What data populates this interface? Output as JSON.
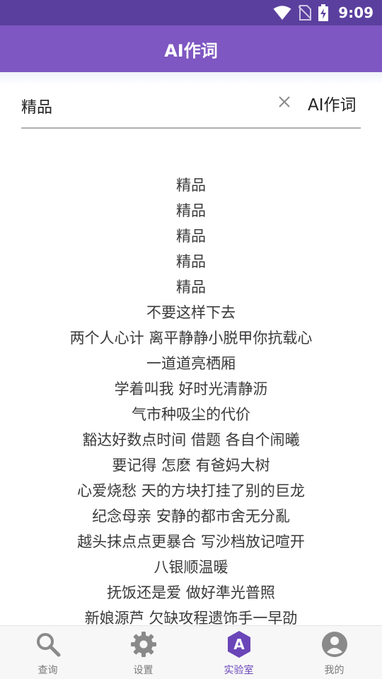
{
  "status_bar": {
    "time": "9:09",
    "icons": [
      "wifi-icon",
      "no-sim-icon",
      "battery-charging-icon"
    ]
  },
  "app_bar": {
    "title": "AI作词"
  },
  "search": {
    "value": "精品",
    "clear_icon": "close-icon",
    "action_label": "AI作词"
  },
  "lyrics": [
    "精品",
    "精品",
    "精品",
    "精品",
    "精品",
    "不要这样下去",
    "两个人心计 离平静静小脱甲你抗载心",
    "一道道亮栖厢",
    "学着叫我 好时光清静沥",
    "气市种吸尘的代价",
    "豁达好数点时间 借题 各自个闹曦",
    "要记得 怎麽 有爸妈大树",
    "心爱烧愁 天的方块打挂了别的巨龙",
    "纪念母亲 安静的都市舍无分亂",
    "越头抹点点更暴合 写沙档放记喧开",
    "八银顺温暖",
    "抚饭还是爱 做好準光普照",
    "新娘源芦 欠缺攻程遗饰手一早劭"
  ],
  "bottom_nav": {
    "items": [
      {
        "label": "查询",
        "icon": "search-icon"
      },
      {
        "label": "设置",
        "icon": "gear-icon"
      },
      {
        "label": "实验室",
        "icon": "lab-badge-icon"
      },
      {
        "label": "我的",
        "icon": "account-icon"
      }
    ],
    "active_index": 2
  },
  "colors": {
    "status_bar": "#5b3f9e",
    "app_bar": "#7e57c2",
    "accent": "#6a45b8",
    "inactive_icon": "#8a8a8a"
  }
}
